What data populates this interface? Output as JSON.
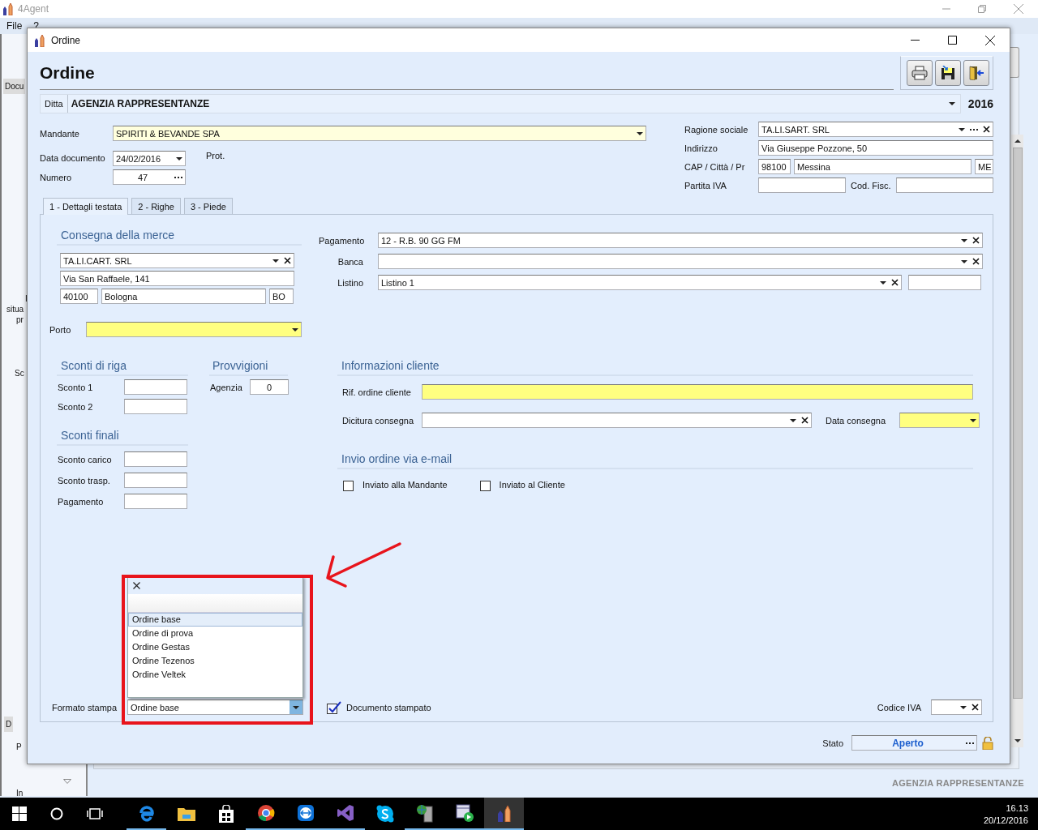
{
  "app": {
    "title": "4Agent",
    "menu": [
      {
        "label": "File"
      },
      {
        "label": "?"
      }
    ],
    "side_fragments": [
      {
        "text": "Docu",
        "kind": "button"
      },
      {
        "text": "I",
        "kind": "text"
      },
      {
        "text": "situa",
        "kind": "text"
      },
      {
        "text": "pr",
        "kind": "text"
      },
      {
        "text": "Sc",
        "kind": "text"
      },
      {
        "text": "D",
        "kind": "button"
      },
      {
        "text": "P",
        "kind": "text"
      },
      {
        "text": "In",
        "kind": "text"
      }
    ],
    "footer": "AGENZIA RAPPRESENTANZE"
  },
  "dialog": {
    "title": "Ordine",
    "heading": "Ordine",
    "toolbar": [
      {
        "kind": "print"
      },
      {
        "kind": "save"
      },
      {
        "kind": "exit"
      }
    ],
    "company": {
      "label": "Ditta",
      "value": "AGENZIA RAPPRESENTANZE",
      "year": "2016"
    },
    "header": {
      "mandante": {
        "label": "Mandante",
        "value": "SPIRITI & BEVANDE SPA",
        "tinted": true,
        "dropdown": true
      },
      "data_documento": {
        "label": "Data documento",
        "value": "24/02/2016",
        "dropdown": true
      },
      "prot": {
        "label": "Prot."
      },
      "numero": {
        "label": "Numero",
        "value": "47",
        "browse": true
      },
      "ragione_sociale": {
        "label": "Ragione sociale",
        "value": "TA.LI.SART. SRL",
        "dropdown": true,
        "browse": true,
        "clearable": true
      },
      "indirizzo": {
        "label": "Indirizzo",
        "value": "Via Giuseppe Pozzone, 50"
      },
      "cap_citta_pr": {
        "label": "CAP / Città / Pr",
        "cap": {
          "value": "98100"
        },
        "citta": {
          "value": "Messina"
        },
        "pr": {
          "value": "ME"
        }
      },
      "partita_iva": {
        "label": "Partita IVA"
      },
      "cod_fisc": {
        "label": "Cod. Fisc."
      }
    },
    "tabs": [
      {
        "label": "1 - Dettagli testata",
        "selected": true
      },
      {
        "label": "2 - Righe",
        "selected": false
      },
      {
        "label": "3 - Piede",
        "selected": false
      }
    ],
    "tab_panel": {
      "consegna": {
        "title": "Consegna della merce",
        "name": {
          "value": "TA.LI.CART. SRL",
          "dropdown": true,
          "clearable": true
        },
        "address": {
          "value": "Via San Raffaele, 141"
        },
        "cap": {
          "value": "40100"
        },
        "city": {
          "value": "Bologna"
        },
        "province": {
          "value": "BO"
        }
      },
      "porto": {
        "label": "Porto",
        "required": true,
        "dropdown": true
      },
      "pagamento": {
        "label": "Pagamento",
        "value": "12 - R.B. 90 GG FM",
        "dropdown": true,
        "clearable": true
      },
      "banca": {
        "label": "Banca",
        "dropdown": true,
        "clearable": true
      },
      "listino": {
        "label": "Listino",
        "value": "Listino 1",
        "dropdown": true,
        "clearable": true
      },
      "sconti_riga": {
        "title": "Sconti di riga",
        "fields": [
          {
            "label": "Sconto 1"
          },
          {
            "label": "Sconto 2"
          }
        ]
      },
      "provvigioni": {
        "title": "Provvigioni",
        "fields": [
          {
            "label": "Agenzia",
            "value": "0"
          }
        ]
      },
      "sconti_finali": {
        "title": "Sconti finali",
        "fields": [
          {
            "label": "Sconto carico"
          },
          {
            "label": "Sconto trasp."
          },
          {
            "label": "Pagamento"
          }
        ]
      },
      "info_cliente": {
        "title": "Informazioni cliente",
        "rif": {
          "label": "Rif. ordine cliente",
          "required": true
        },
        "dicitura": {
          "label": "Dicitura consegna",
          "dropdown": true,
          "clearable": true
        },
        "data_consegna": {
          "label": "Data consegna",
          "required": true,
          "dropdown": true
        }
      },
      "invio_email": {
        "title": "Invio ordine via e-mail",
        "options": [
          {
            "label": "Inviato alla Mandante",
            "checked": false
          },
          {
            "label": "Inviato al Cliente",
            "checked": false
          }
        ]
      },
      "formato_stampa": {
        "label": "Formato stampa",
        "value": "Ordine base",
        "expanded": true,
        "options": [
          {
            "label": "Ordine base",
            "selected": true
          },
          {
            "label": "Ordine di prova",
            "selected": false
          },
          {
            "label": "Ordine Gestas",
            "selected": false
          },
          {
            "label": "Ordine Tezenos",
            "selected": false
          },
          {
            "label": "Ordine Veltek",
            "selected": false
          }
        ]
      },
      "documento_stampato": {
        "label": "Documento stampato",
        "checked": true
      },
      "codice_iva": {
        "label": "Codice IVA",
        "dropdown": true,
        "clearable": true
      }
    },
    "stato": {
      "label": "Stato",
      "value": "Aperto",
      "browse": true,
      "locked": false
    }
  },
  "taskbar": {
    "time": "16.13",
    "date": "20/12/2016"
  }
}
